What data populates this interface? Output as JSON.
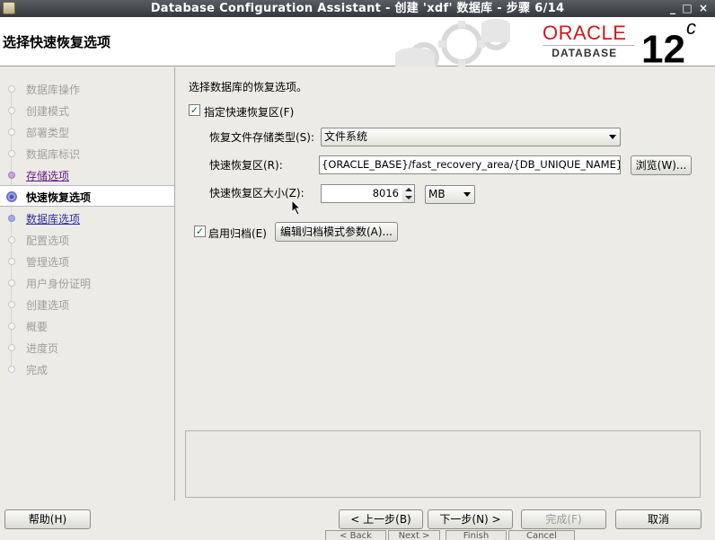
{
  "window": {
    "title": "Database Configuration Assistant - 创建 'xdf' 数据库 - 步骤 6/14",
    "controls": [
      "_",
      "□",
      "×"
    ]
  },
  "header": {
    "page_title": "选择快速恢复选项",
    "logo_brand": "ORACLE",
    "logo_product": "DATABASE",
    "logo_version": "12",
    "logo_version_suffix": "c"
  },
  "nav": {
    "items": [
      {
        "label": "数据库操作",
        "state": "disabled"
      },
      {
        "label": "创建模式",
        "state": "disabled"
      },
      {
        "label": "部署类型",
        "state": "disabled"
      },
      {
        "label": "数据库标识",
        "state": "disabled"
      },
      {
        "label": "存储选项",
        "state": "visited"
      },
      {
        "label": "快速恢复选项",
        "state": "active"
      },
      {
        "label": "数据库选项",
        "state": "link"
      },
      {
        "label": "配置选项",
        "state": "disabled"
      },
      {
        "label": "管理选项",
        "state": "disabled"
      },
      {
        "label": "用户身份证明",
        "state": "disabled"
      },
      {
        "label": "创建选项",
        "state": "disabled"
      },
      {
        "label": "概要",
        "state": "disabled"
      },
      {
        "label": "进度页",
        "state": "disabled"
      },
      {
        "label": "完成",
        "state": "disabled"
      }
    ]
  },
  "main": {
    "section_title": "选择数据库的恢复选项。",
    "fra_checkbox": {
      "label": "指定快速恢复区(F)",
      "checked": true
    },
    "storage_type": {
      "label": "恢复文件存储类型(S):",
      "value": "文件系统"
    },
    "fra_location": {
      "label": "快速恢复区(R):",
      "value": "{ORACLE_BASE}/fast_recovery_area/{DB_UNIQUE_NAME}",
      "browse_label": "浏览(W)..."
    },
    "fra_size": {
      "label": "快速恢复区大小(Z):",
      "value": "8016",
      "unit": "MB"
    },
    "archive_checkbox": {
      "label": "启用归档(E)",
      "checked": true
    },
    "edit_archive_button": "编辑归档模式参数(A)..."
  },
  "footer": {
    "help": "帮助(H)",
    "back": "< 上一步(B)",
    "next": "下一步(N) >",
    "finish": "完成(F)",
    "cancel": "取消"
  },
  "ghost_footer": {
    "back": "< Back",
    "next": "Next >",
    "finish": "Finish",
    "cancel": "Cancel"
  },
  "colors": {
    "oracle_red": "#d2181e",
    "active_nav": "#4955c4",
    "link_nav": "#2e2ea0",
    "visited_nav": "#6a1b8a"
  }
}
